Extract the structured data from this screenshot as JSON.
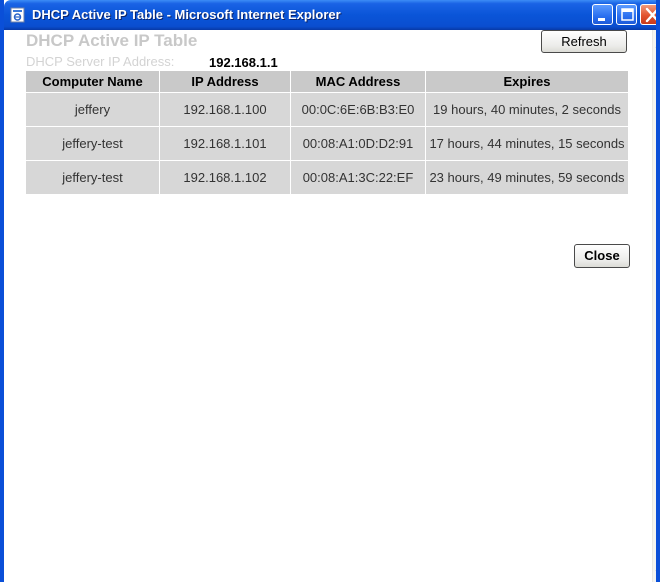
{
  "window": {
    "title": "DHCP Active IP Table - Microsoft Internet Explorer",
    "accent_color": "#0a55d8",
    "close_color": "#e2532e"
  },
  "page": {
    "title": "DHCP Active IP Table",
    "server_label": "DHCP Server IP Address:",
    "server_ip": "192.168.1.1",
    "refresh_label": "Refresh",
    "close_label": "Close"
  },
  "table": {
    "headers": [
      "Computer Name",
      "IP Address",
      "MAC Address",
      "Expires"
    ],
    "rows": [
      [
        "jeffery",
        "192.168.1.100",
        "00:0C:6E:6B:B3:E0",
        "19 hours, 40 minutes, 2 seconds"
      ],
      [
        "jeffery-test",
        "192.168.1.101",
        "00:08:A1:0D:D2:91",
        "17 hours, 44 minutes, 15 seconds"
      ],
      [
        "jeffery-test",
        "192.168.1.102",
        "00:08:A1:3C:22:EF",
        "23 hours, 49 minutes, 59 seconds"
      ]
    ]
  }
}
